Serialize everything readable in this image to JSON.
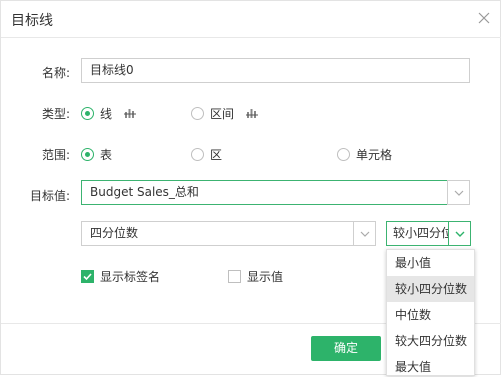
{
  "dialog": {
    "title": "目标线"
  },
  "form": {
    "name": {
      "label": "名称:",
      "value": "目标线0"
    },
    "type": {
      "label": "类型:",
      "options": [
        {
          "text": "线",
          "icon": "bar-chart-icon",
          "selected": true
        },
        {
          "text": "区间",
          "icon": "bar-chart-icon",
          "selected": false
        }
      ]
    },
    "range": {
      "label": "范围:",
      "options": [
        {
          "text": "表",
          "selected": true
        },
        {
          "text": "区",
          "selected": false
        },
        {
          "text": "单元格",
          "selected": false
        }
      ]
    },
    "target": {
      "label": "目标值:",
      "field_value": "Budget Sales_总和",
      "method_value": "四分位数",
      "quartile_value": "较小四分位"
    },
    "checks": {
      "show_label": {
        "text": "显示标签名",
        "checked": true
      },
      "show_value": {
        "text": "显示值",
        "checked": false
      }
    }
  },
  "footer": {
    "ok_label": "确定"
  },
  "dropdown": {
    "options": [
      "最小值",
      "较小四分位数",
      "中位数",
      "较大四分位数",
      "最大值"
    ],
    "highlighted": "较小四分位数"
  },
  "colors": {
    "accent": "#2db36a",
    "border": "#cfcfcf",
    "hover": "#e6e6e6"
  }
}
